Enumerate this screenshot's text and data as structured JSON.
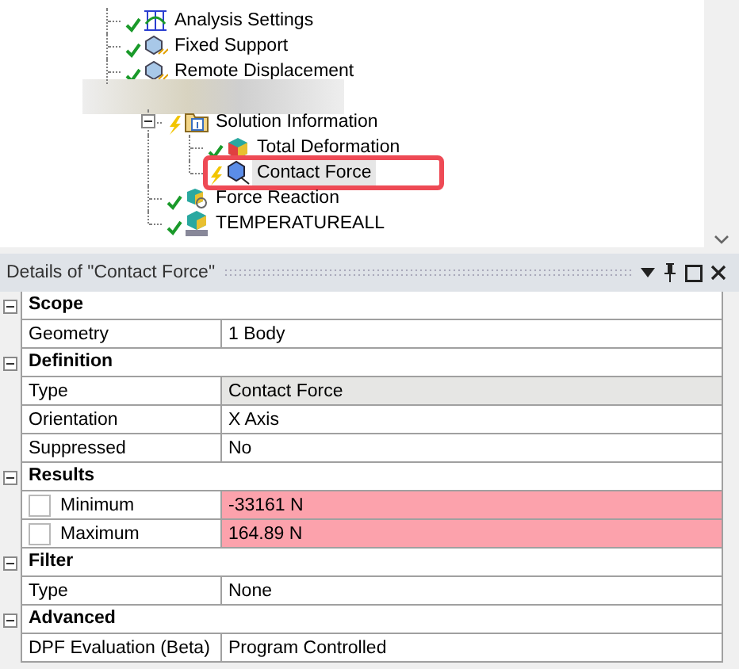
{
  "tree": {
    "items": [
      {
        "label": "Analysis Settings",
        "kind": "settings",
        "solved": true,
        "selected": false,
        "highlighted": false
      },
      {
        "label": "Fixed Support",
        "kind": "support",
        "solved": true,
        "selected": false,
        "highlighted": false
      },
      {
        "label": "Remote Displacement",
        "kind": "support",
        "solved": true,
        "selected": false,
        "highlighted": false
      },
      {
        "kind": "redacted",
        "children": [
          {
            "label": "Solution Information",
            "kind": "info",
            "solved": false,
            "expanded": true,
            "selected": false,
            "highlighted": false,
            "children": [
              {
                "label": "Total Deformation",
                "kind": "result",
                "solved": true,
                "selected": false,
                "highlighted": false
              },
              {
                "label": "Contact Force",
                "kind": "probe",
                "solved": false,
                "selected": true,
                "highlighted": true
              }
            ]
          },
          {
            "label": "Force Reaction",
            "kind": "reaction",
            "solved": true,
            "selected": false,
            "highlighted": false
          },
          {
            "label": "TEMPERATUREALL",
            "kind": "user",
            "solved": true,
            "selected": false,
            "highlighted": false
          }
        ]
      }
    ]
  },
  "details": {
    "title": "Details of \"Contact Force\"",
    "sections": [
      {
        "title": "Scope",
        "expanded": true,
        "rows": [
          {
            "label": "Geometry",
            "value": "1 Body",
            "kind": "plain"
          }
        ]
      },
      {
        "title": "Definition",
        "expanded": true,
        "rows": [
          {
            "label": "Type",
            "value": "Contact Force",
            "kind": "readonly"
          },
          {
            "label": "Orientation",
            "value": "X Axis",
            "kind": "plain"
          },
          {
            "label": "Suppressed",
            "value": "No",
            "kind": "plain"
          }
        ]
      },
      {
        "title": "Results",
        "expanded": true,
        "rows": [
          {
            "label": "Minimum",
            "value": "-33161 N",
            "kind": "result",
            "checked": false
          },
          {
            "label": "Maximum",
            "value": "164.89 N",
            "kind": "result",
            "checked": false
          }
        ]
      },
      {
        "title": "Filter",
        "expanded": true,
        "rows": [
          {
            "label": "Type",
            "value": "None",
            "kind": "plain"
          }
        ]
      },
      {
        "title": "Advanced",
        "expanded": true,
        "rows": [
          {
            "label": "DPF Evaluation (Beta)",
            "value": "Program Controlled",
            "kind": "plain"
          }
        ]
      }
    ]
  }
}
